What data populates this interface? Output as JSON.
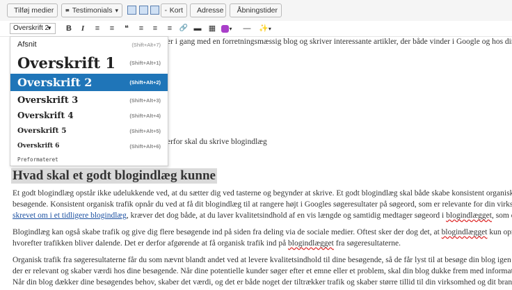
{
  "media_bar": {
    "add_media": "Tilføj medier",
    "testimonials": "Testimonials",
    "map": "Kort",
    "address": "Adresse",
    "hours": "Åbningstider"
  },
  "toolbar": {
    "format_value": "Overskrift 2",
    "bold": "B",
    "italic": "I",
    "ul": "≡",
    "ol": "≡",
    "quote": "❝",
    "align_left": "≡",
    "align_center": "≡",
    "align_right": "≡",
    "link": "🔗",
    "more": "▬",
    "table": "▦",
    "hr": "—",
    "wand": "✨"
  },
  "dropdown": {
    "items": [
      {
        "label": "Afsnit",
        "shortcut": "(Shift+Alt+7)"
      },
      {
        "label": "Overskrift 1",
        "shortcut": "(Shift+Alt+1)"
      },
      {
        "label": "Overskrift 2",
        "shortcut": "(Shift+Alt+2)"
      },
      {
        "label": "Overskrift 3",
        "shortcut": "(Shift+Alt+3)"
      },
      {
        "label": "Overskrift 4",
        "shortcut": "(Shift+Alt+4)"
      },
      {
        "label": "Overskrift 5",
        "shortcut": "(Shift+Alt+5)"
      },
      {
        "label": "Overskrift 6",
        "shortcut": "(Shift+Alt+6)"
      },
      {
        "label": "Preformateret",
        "shortcut": ""
      }
    ]
  },
  "content": {
    "line1": "er i gang med en forretningsmæssig blog og skriver interessante artikler, der både vinder i Google og hos din",
    "line2": "erfor skal du skrive blogindlæg",
    "heading": "Hvad skal et godt blogindlæg kunne",
    "p1_a": "Et godt blogindlæg opstår ikke udelukkende ved, at du sætter dig ved tasterne og begynder at skrive. Et godt blogindlæg skal både skabe konsistent organisk tra",
    "p1_b": "besøgende. Konsistent organisk trafik opnår du ved at få dit blogindlæg til at rangere højt i Googles søgeresultater på søgeord, som er relevante for din virksom",
    "p1_c_link": "skrevet om i et tidligere blogindlæg",
    "p1_c_rest": ", kræver det dog både, at du laver kvalitetsindhold af en vis længde og samtidig medtager søgeord i ",
    "p1_c_sp": "blogindlægget",
    "p1_c_end": ", som du o",
    "p2_a1": "Blogindlæg kan også skabe trafik og give dig flere besøgende ind på siden fra deling via de sociale medier. Oftest sker der dog det, at ",
    "p2_a_sp": "blogindlægget",
    "p2_a2": " kun opnår o",
    "p2_b1": "hvorefter trafikken bliver dalende. Det er derfor afgørende at få organisk trafik ind på ",
    "p2_b_sp": "blogindlægget",
    "p2_b2": " fra søgeresultaterne.",
    "p3_a": "Organisk trafik fra søgeresultaterne får du som nævnt blandt andet ved at levere kvalitetsindhold til dine besøgende, så de får lyst til at besøge din blog igen og",
    "p3_b": "der er relevant og skaber værdi hos dine besøgende. Når dine potentielle kunder søger efter et emne eller et problem, skal din blog dukke frem med information",
    "p3_c": "Når din blog dækker dine besøgendes behov, skaber det værdi, og det er både noget der tiltrækker trafik og skaber større tillid til din virksomhed og dit brand h"
  },
  "colors": {
    "accent": "#1f75b8",
    "link": "#1a4fa0"
  }
}
